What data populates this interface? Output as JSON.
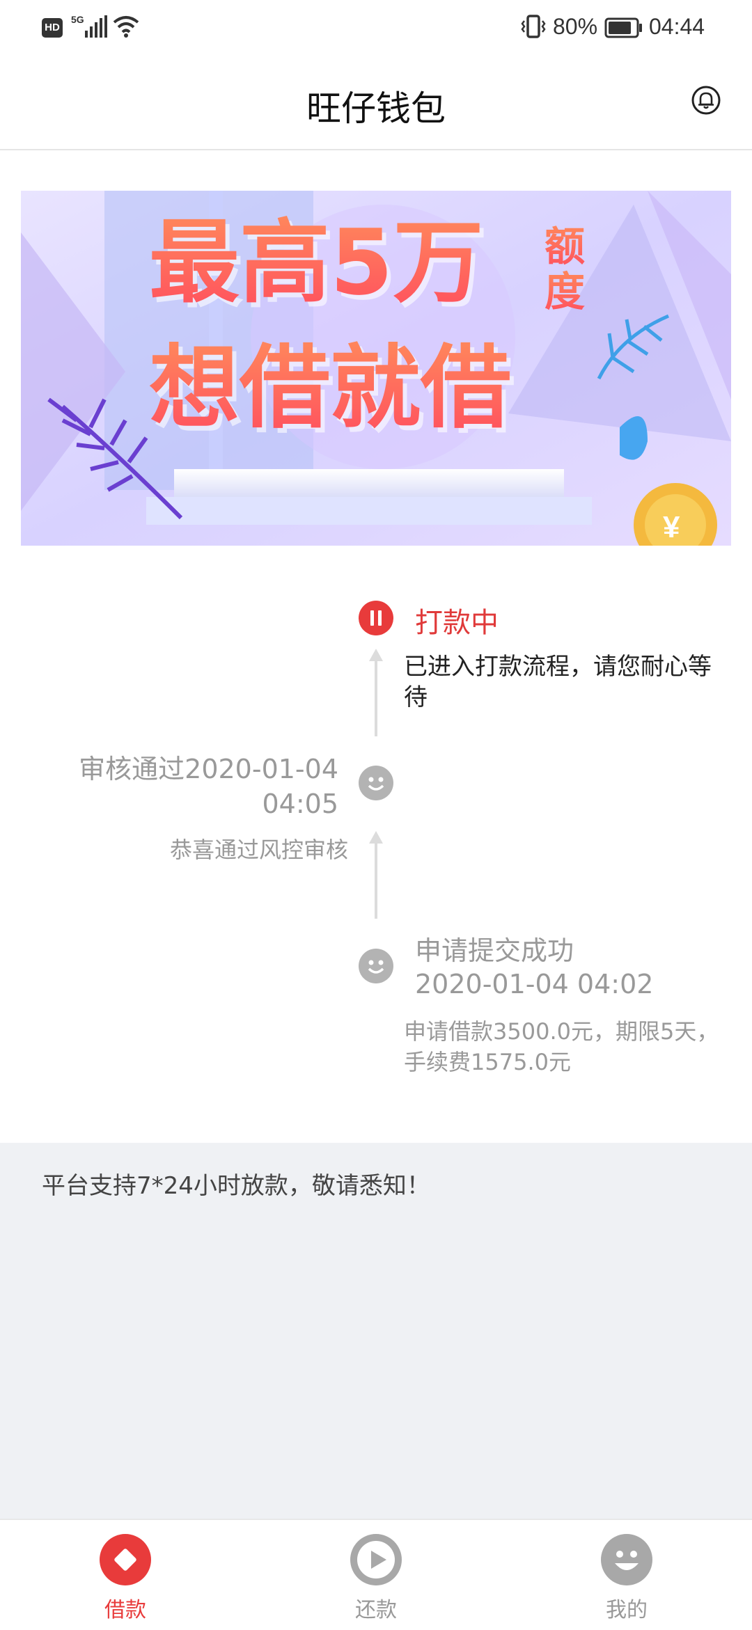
{
  "status_bar": {
    "hd": "HD",
    "network": "5G",
    "battery_percent": "80%",
    "time": "04:44"
  },
  "header": {
    "title": "旺仔钱包",
    "bell_icon": "bell-icon"
  },
  "banner": {
    "line1": "最高5万",
    "line1_suffix_a": "额",
    "line1_suffix_b": "度",
    "line2": "想借就借"
  },
  "timeline": {
    "step1": {
      "status": "active",
      "title": "打款中",
      "desc": "已进入打款流程，请您耐心等待"
    },
    "step2": {
      "status": "done",
      "title_line1": "审核通过2020-01-04",
      "title_line2": "04:05",
      "desc": "恭喜通过风控审核"
    },
    "step3": {
      "status": "done",
      "title_line1": "申请提交成功",
      "title_line2": "2020-01-04 04:02",
      "desc": "申请借款3500.0元，期限5天，手续费1575.0元"
    }
  },
  "notice": "平台支持7*24小时放款，敬请悉知！",
  "bottom_nav": [
    {
      "label": "借款",
      "icon": "diamond-icon",
      "active": true
    },
    {
      "label": "还款",
      "icon": "play-icon",
      "active": false
    },
    {
      "label": "我的",
      "icon": "smiley-icon",
      "active": false
    }
  ],
  "colors": {
    "accent": "#e83b3b",
    "inactive": "#a8a8a8",
    "notice_bg": "#eff1f4"
  }
}
